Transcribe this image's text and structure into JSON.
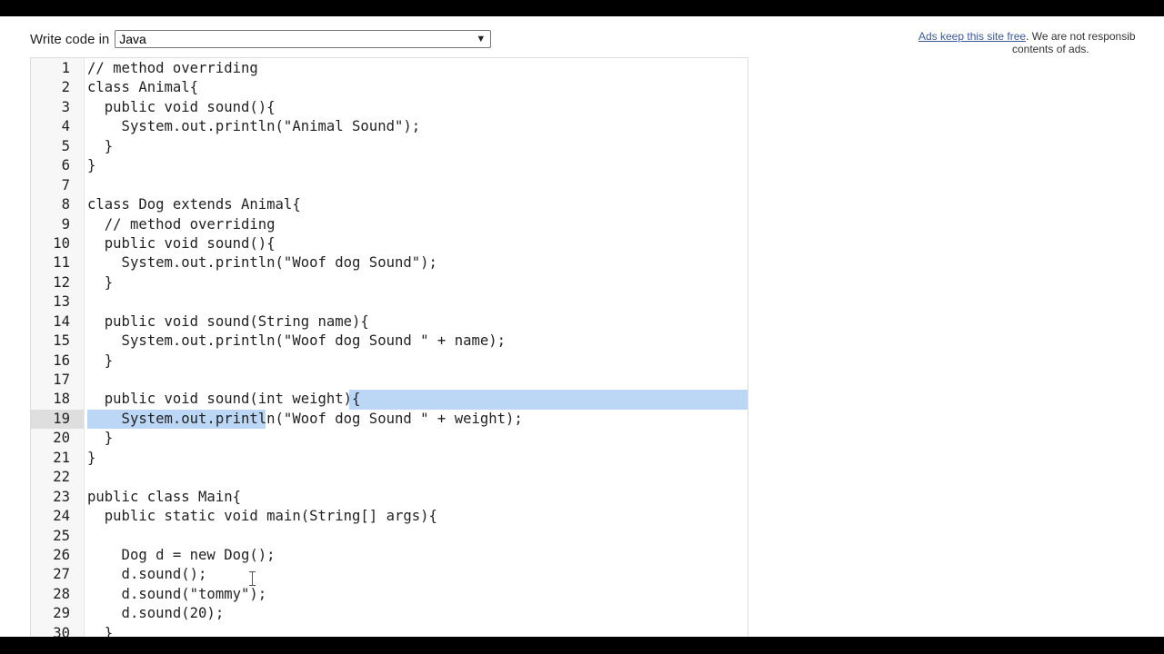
{
  "toolbar": {
    "label": "Write code in",
    "language_selected": "Java"
  },
  "ads": {
    "link_text": "Ads keep this site free",
    "rest_text": ". We are not responsib",
    "line2": "contents of ads."
  },
  "editor": {
    "active_line": 19,
    "lines": [
      {
        "n": "1",
        "text": "// method overriding"
      },
      {
        "n": "2",
        "text": "class Animal{"
      },
      {
        "n": "3",
        "text": "  public void sound(){"
      },
      {
        "n": "4",
        "text": "    System.out.println(\"Animal Sound\");"
      },
      {
        "n": "5",
        "text": "  }"
      },
      {
        "n": "6",
        "text": "}"
      },
      {
        "n": "7",
        "text": ""
      },
      {
        "n": "8",
        "text": "class Dog extends Animal{"
      },
      {
        "n": "9",
        "text": "  // method overriding"
      },
      {
        "n": "10",
        "text": "  public void sound(){"
      },
      {
        "n": "11",
        "text": "    System.out.println(\"Woof dog Sound\");"
      },
      {
        "n": "12",
        "text": "  }"
      },
      {
        "n": "13",
        "text": ""
      },
      {
        "n": "14",
        "text": "  public void sound(String name){"
      },
      {
        "n": "15",
        "text": "    System.out.println(\"Woof dog Sound \" + name);"
      },
      {
        "n": "16",
        "text": "  }"
      },
      {
        "n": "17",
        "text": ""
      },
      {
        "n": "18",
        "text": "  public void sound(int weight){"
      },
      {
        "n": "19",
        "text": "    System.out.println(\"Woof dog Sound \" + weight);"
      },
      {
        "n": "20",
        "text": "  }"
      },
      {
        "n": "21",
        "text": "}"
      },
      {
        "n": "22",
        "text": ""
      },
      {
        "n": "23",
        "text": "public class Main{"
      },
      {
        "n": "24",
        "text": "  public static void main(String[] args){"
      },
      {
        "n": "25",
        "text": ""
      },
      {
        "n": "26",
        "text": "    Dog d = new Dog();"
      },
      {
        "n": "27",
        "text": "    d.sound();"
      },
      {
        "n": "28",
        "text": "    d.sound(\"tommy\");"
      },
      {
        "n": "29",
        "text": "    d.sound(20);"
      },
      {
        "n": "30",
        "text": "  }"
      }
    ]
  }
}
